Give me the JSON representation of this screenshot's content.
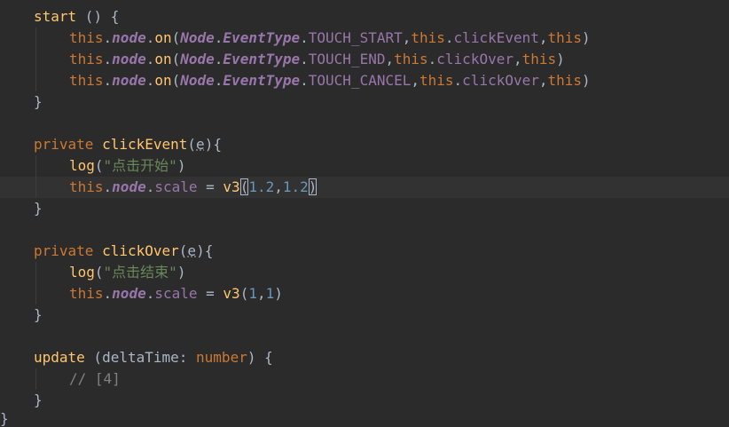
{
  "code": {
    "l1": {
      "method": "start",
      "sig": " () {"
    },
    "l2": {
      "this": "this",
      "node": "node",
      "on": "on",
      "Node": "Node",
      "EventType": "EventType",
      "const": "TOUCH_START",
      "this2": "this",
      "handler": "clickEvent",
      "this3": "this"
    },
    "l3": {
      "const": "TOUCH_END",
      "handler": "clickOver"
    },
    "l4": {
      "const": "TOUCH_CANCEL",
      "handler": "clickOver"
    },
    "l5": "}",
    "l7": {
      "kw": "private",
      "method": "clickEvent",
      "param": "e"
    },
    "l8": {
      "fn": "log",
      "str": "\"点击开始\""
    },
    "l9": {
      "scale": "scale",
      "fn": "v3",
      "a": "1.2",
      "b": "1.2"
    },
    "l10": "}",
    "l12": {
      "kw": "private",
      "method": "clickOver",
      "param": "e"
    },
    "l13": {
      "fn": "log",
      "str": "\"点击结束\""
    },
    "l14": {
      "scale": "scale",
      "fn": "v3",
      "a": "1",
      "b": "1"
    },
    "l15": "}",
    "l17": {
      "method": "update",
      "param": "deltaTime",
      "type": "number"
    },
    "l18": "// [4]",
    "l19": "}",
    "l20": "}"
  }
}
